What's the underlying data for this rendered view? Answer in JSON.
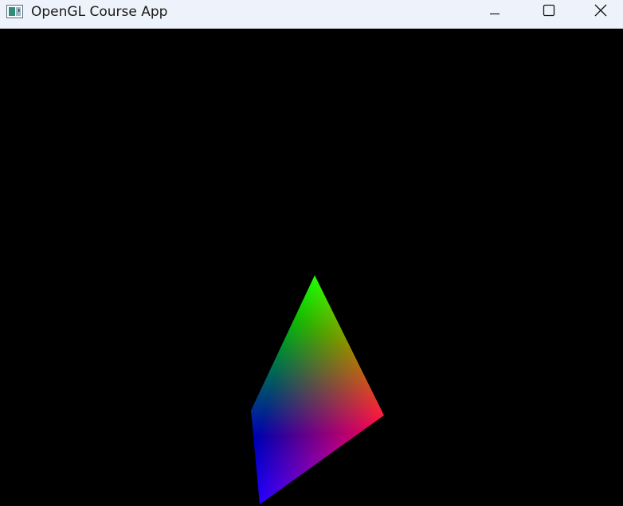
{
  "window": {
    "title": "OpenGL Course App",
    "app_icon": "window-app-icon",
    "controls": {
      "minimize_icon": "minimize-icon",
      "maximize_icon": "maximize-icon",
      "close_icon": "close-icon"
    }
  },
  "canvas": {
    "background": "#000000",
    "shape": "triangle-gradient",
    "vertex_colors": [
      "#00ff00",
      "#ff0000",
      "#0000ff"
    ]
  }
}
